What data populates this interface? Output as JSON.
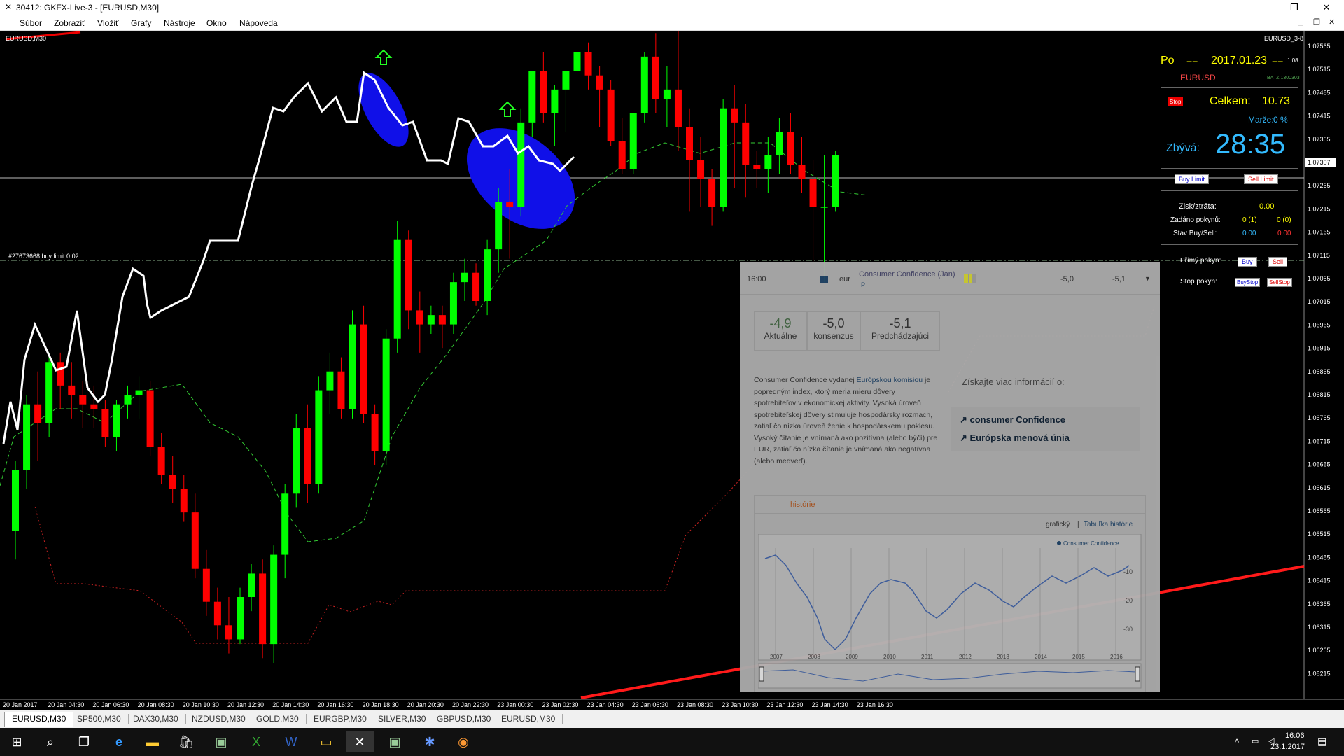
{
  "window": {
    "title": "30412: GKFX-Live-3 - [EURUSD,M30]",
    "minimize": "—",
    "maximize": "❐",
    "close": "✕",
    "app_icon": "✕"
  },
  "menu": {
    "items": [
      "Súbor",
      "Zobraziť",
      "Vložiť",
      "Grafy",
      "Nástroje",
      "Okno",
      "Nápoveda"
    ],
    "child_controls": [
      "_",
      "❐",
      "✕"
    ]
  },
  "chart": {
    "symbol_label": "EURUSD,M30",
    "right_label": "EURUSD_3-8",
    "order_label": "#27673668 buy limit 0.02",
    "current_price": "1.07307",
    "price_ticks": [
      "1.07565",
      "1.07515",
      "1.07465",
      "1.07415",
      "1.07365",
      "1.07307",
      "1.07265",
      "1.07215",
      "1.07165",
      "1.07115",
      "1.07065",
      "1.07015",
      "1.06965",
      "1.06915",
      "1.06865",
      "1.06815",
      "1.06765",
      "1.06715",
      "1.06665",
      "1.06615",
      "1.06565",
      "1.06515",
      "1.06465",
      "1.06415",
      "1.06365",
      "1.06315",
      "1.06265",
      "1.06215"
    ],
    "time_ticks": [
      "20 Jan 2017",
      "20 Jan 04:30",
      "20 Jan 06:30",
      "20 Jan 08:30",
      "20 Jan 10:30",
      "20 Jan 12:30",
      "20 Jan 14:30",
      "20 Jan 16:30",
      "20 Jan 18:30",
      "20 Jan 20:30",
      "20 Jan 22:30",
      "23 Jan 00:30",
      "23 Jan 02:30",
      "23 Jan 04:30",
      "23 Jan 06:30",
      "23 Jan 08:30",
      "23 Jan 10:30",
      "23 Jan 12:30",
      "23 Jan 14:30",
      "23 Jan 16:30"
    ]
  },
  "chart_data": {
    "type": "candlestick",
    "title": "EURUSD,M30",
    "ylim": [
      1.0619,
      1.0759
    ],
    "candles": [
      [
        1.0654,
        1.0669,
        1.0648,
        1.0667
      ],
      [
        1.0667,
        1.0683,
        1.0663,
        1.0681
      ],
      [
        1.0681,
        1.0688,
        1.0669,
        1.0677
      ],
      [
        1.0677,
        1.0692,
        1.0674,
        1.069
      ],
      [
        1.069,
        1.0692,
        1.068,
        1.0685
      ],
      [
        1.0685,
        1.069,
        1.0678,
        1.0683
      ],
      [
        1.0683,
        1.0686,
        1.0676,
        1.0681
      ],
      [
        1.0681,
        1.0685,
        1.0676,
        1.068
      ],
      [
        1.068,
        1.0682,
        1.0672,
        1.0674
      ],
      [
        1.0674,
        1.0682,
        1.0671,
        1.0681
      ],
      [
        1.0681,
        1.0685,
        1.0678,
        1.0683
      ],
      [
        1.0683,
        1.0687,
        1.0678,
        1.0684
      ],
      [
        1.0684,
        1.0686,
        1.067,
        1.0672
      ],
      [
        1.0672,
        1.0675,
        1.0664,
        1.0666
      ],
      [
        1.0666,
        1.067,
        1.066,
        1.0663
      ],
      [
        1.0663,
        1.0666,
        1.0656,
        1.0658
      ],
      [
        1.0658,
        1.0662,
        1.0644,
        1.0646
      ],
      [
        1.0646,
        1.065,
        1.0636,
        1.0639
      ],
      [
        1.0639,
        1.0642,
        1.0631,
        1.0634
      ],
      [
        1.0634,
        1.064,
        1.0628,
        1.0631
      ],
      [
        1.0631,
        1.0642,
        1.063,
        1.064
      ],
      [
        1.064,
        1.0647,
        1.0637,
        1.0645
      ],
      [
        1.0645,
        1.0648,
        1.0627,
        1.063
      ],
      [
        1.063,
        1.0651,
        1.0626,
        1.0649
      ],
      [
        1.0649,
        1.0664,
        1.0644,
        1.0662
      ],
      [
        1.0662,
        1.0679,
        1.0659,
        1.0676
      ],
      [
        1.0676,
        1.0681,
        1.066,
        1.0664
      ],
      [
        1.0664,
        1.0687,
        1.0662,
        1.0684
      ],
      [
        1.0684,
        1.0692,
        1.0679,
        1.0688
      ],
      [
        1.0688,
        1.0691,
        1.0678,
        1.068
      ],
      [
        1.068,
        1.0701,
        1.0678,
        1.0698
      ],
      [
        1.0698,
        1.0702,
        1.0677,
        1.0679
      ],
      [
        1.0679,
        1.0681,
        1.0668,
        1.0671
      ],
      [
        1.0671,
        1.0697,
        1.0668,
        1.0695
      ],
      [
        1.0695,
        1.072,
        1.0692,
        1.0716
      ],
      [
        1.0716,
        1.0718,
        1.0697,
        1.0701
      ],
      [
        1.0701,
        1.0705,
        1.0692,
        1.0698
      ],
      [
        1.0698,
        1.0702,
        1.0696,
        1.07
      ],
      [
        1.07,
        1.0702,
        1.0693,
        1.0698
      ],
      [
        1.0698,
        1.0709,
        1.0696,
        1.0707
      ],
      [
        1.0707,
        1.0712,
        1.0703,
        1.0709
      ],
      [
        1.0709,
        1.0711,
        1.0702,
        1.0703
      ],
      [
        1.0703,
        1.0716,
        1.07,
        1.0714
      ],
      [
        1.0714,
        1.0727,
        1.0709,
        1.0724
      ],
      [
        1.0724,
        1.0731,
        1.0712,
        1.0723
      ],
      [
        1.0723,
        1.0744,
        1.0721,
        1.0741
      ],
      [
        1.0741,
        1.0752,
        1.0738,
        1.0752
      ],
      [
        1.0752,
        1.0756,
        1.0741,
        1.0743
      ],
      [
        1.0743,
        1.0749,
        1.0736,
        1.0748
      ],
      [
        1.0748,
        1.0752,
        1.0739,
        1.0752
      ],
      [
        1.0752,
        1.0757,
        1.0746,
        1.0756
      ],
      [
        1.0756,
        1.0758,
        1.0748,
        1.0751
      ],
      [
        1.0751,
        1.0753,
        1.074,
        1.0748
      ],
      [
        1.0748,
        1.075,
        1.0736,
        1.0737
      ],
      [
        1.0737,
        1.0742,
        1.073,
        1.0731
      ],
      [
        1.0731,
        1.0743,
        1.073,
        1.0743
      ],
      [
        1.0743,
        1.0756,
        1.0741,
        1.0755
      ],
      [
        1.0755,
        1.076,
        1.0743,
        1.0746
      ],
      [
        1.0746,
        1.0753,
        1.074,
        1.0748
      ],
      [
        1.0748,
        1.0761,
        1.0735,
        1.074
      ],
      [
        1.074,
        1.0744,
        1.0722,
        1.0733
      ],
      [
        1.0733,
        1.0738,
        1.0723,
        1.0729
      ],
      [
        1.0729,
        1.0731,
        1.0719,
        1.0723
      ],
      [
        1.0723,
        1.0746,
        1.0722,
        1.0744
      ],
      [
        1.0744,
        1.0749,
        1.0727,
        1.0741
      ],
      [
        1.0741,
        1.0745,
        1.0725,
        1.0732
      ],
      [
        1.0732,
        1.0735,
        1.0727,
        1.0731
      ],
      [
        1.0731,
        1.0738,
        1.0726,
        1.0734
      ],
      [
        1.0734,
        1.0742,
        1.073,
        1.0739
      ],
      [
        1.0739,
        1.0743,
        1.073,
        1.0732
      ],
      [
        1.0732,
        1.0738,
        1.0726,
        1.0729
      ],
      [
        1.0729,
        1.0733,
        1.0709,
        1.0723
      ],
      [
        1.0723,
        1.0734,
        1.0707,
        1.0723
      ],
      [
        1.0723,
        1.0735,
        1.0722,
        1.0734
      ]
    ]
  },
  "panel": {
    "day_label": "Po",
    "eq1": "==",
    "date": "2017.01.23",
    "eq2": "==",
    "ver": "1.08",
    "symbol": "EURUSD",
    "small": "BA_Z.1300303",
    "stop_btn": "Stop",
    "celkem_label": "Celkem:",
    "celkem_value": "10.73",
    "marza_label": "Marže:",
    "marza_value": "0 %",
    "zbyva_label": "Zbývá:",
    "zbyva_value": "28:35",
    "buy_limit": "Buy Limit",
    "sell_limit": "Sell Limit",
    "zisk_label": "Zisk/ztráta:",
    "zisk_value": "0.00",
    "zadano_label": "Zadáno pokynů:",
    "zadano_buy": "0 (1)",
    "zadano_sell": "0 (0)",
    "stav_label": "Stav Buy/Sell:",
    "stav_buy": "0.00",
    "stav_sell": "0.00",
    "primy_label": "Přímý pokyn:",
    "buy": "Buy",
    "sell": "Sell",
    "stop_label": "Stop pokyn:",
    "buystop": "BuyStop",
    "sellstop": "SellStop"
  },
  "news": {
    "time": "16:00",
    "currency": "eur",
    "event": "Consumer Confidence (Jan)",
    "event_flag": "P",
    "forecast": "-5,0",
    "previous": "-5,1",
    "actual_value": "-4,9",
    "actual_label": "Aktuálne",
    "cons_value": "-5,0",
    "cons_label": "konsenzus",
    "prev_value": "-5,1",
    "prev_label": "Predchádzajúci",
    "desc_before": "Consumer Confidence vydanej ",
    "desc_link": "Európskou komisiou",
    "desc_after": " je popredným index, ktorý meria mieru dôvery spotrebiteľov v ekonomickej aktivity. Vysoká úroveň spotrebiteľskej dôvery stimuluje hospodársky rozmach, zatiaľ čo nízka úroveň ženie k hospodárskemu poklesu. Vysoký čítanie je vnímaná ako pozitívna (alebo býčí) pre EUR, zatiaľ čo nízka čítanie je vnímaná ako negatívna (alebo medveď).",
    "more_info": "Získajte viac informácií o:",
    "link1": "consumer Confidence",
    "link2": "Európska menová únia",
    "tab_history": "histórie",
    "view_graph": "grafický",
    "view_sep": "|",
    "view_table": "Tabuľka histórie",
    "legend": "Consumer Confidence",
    "years": [
      "2007",
      "2008",
      "2009",
      "2010",
      "2011",
      "2012",
      "2013",
      "2014",
      "2015",
      "2016"
    ],
    "yticks": [
      "-10",
      "-20",
      "-30"
    ]
  },
  "tabs": [
    "EURUSD,M30",
    "SP500,M30",
    "DAX30,M30",
    "NZDUSD,M30",
    "GOLD,M30",
    "EURGBP,M30",
    "SILVER,M30",
    "GBPUSD,M30",
    "EURUSD,M30"
  ],
  "taskbar": {
    "time": "16:06",
    "date": "23.1.2017"
  }
}
